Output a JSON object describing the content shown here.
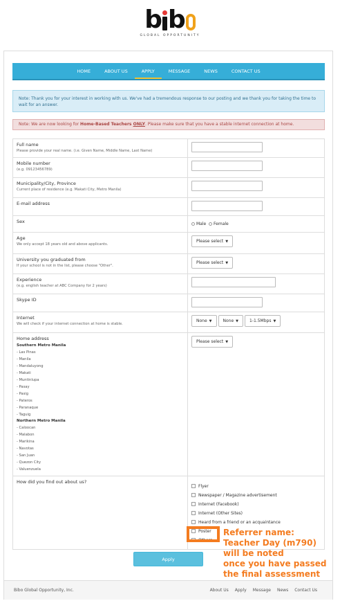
{
  "logo": {
    "tagline": "GLOBAL OPPORTUNITY"
  },
  "nav": {
    "items": [
      {
        "label": "HOME"
      },
      {
        "label": "ABOUT US"
      },
      {
        "label": "APPLY"
      },
      {
        "label": "MESSAGE"
      },
      {
        "label": "NEWS"
      },
      {
        "label": "CONTACT US"
      }
    ],
    "active": "APPLY"
  },
  "notes": {
    "info": "Note: Thank you for your interest in working with us. We've had a tremendous response to our posting and we thank you for taking the time to wait for an answer.",
    "warn_prefix": "Note: We are now looking for ",
    "warn_bold": "Home-Based Teachers ",
    "warn_only": "ONLY",
    "warn_suffix": ". Please make sure that you have a stable internet connection at home."
  },
  "form": {
    "full_name": {
      "label": "Full name",
      "hint": "Please provide your real name. (i.e. Given Name, Middle Name, Last Name)"
    },
    "mobile": {
      "label": "Mobile number",
      "hint": "(e.g. 09123456789)"
    },
    "municipality": {
      "label": "Municipality/City, Province",
      "hint": "Current place of residence (e.g. Makati City, Metro Manila)"
    },
    "email": {
      "label": "E-mail address"
    },
    "sex": {
      "label": "Sex",
      "options": [
        "Male",
        "Female"
      ]
    },
    "age": {
      "label": "Age",
      "hint": "We only accept 18 years old and above applicants.",
      "select": "Please select"
    },
    "university": {
      "label": "University you graduated from",
      "hint": "If your school is not in the list, please choose \"Other\".",
      "select": "Please select"
    },
    "experience": {
      "label": "Experience",
      "hint": "(e.g. english teacher at ABC Company for 2 years)"
    },
    "skype": {
      "label": "Skype ID"
    },
    "internet": {
      "label": "Internet",
      "hint": "We will check if your internet connection at home is stable.",
      "selects": [
        "None",
        "None",
        "1-1.5Mbps"
      ]
    },
    "home_address": {
      "label": "Home address",
      "select": "Please select",
      "south_head": "Southern Metro Manila",
      "south": [
        "- Las Pinas",
        "- Manila",
        "- Mandaluyong",
        "- Makati",
        "- Muntinlupa",
        "- Pasay",
        "- Pasig",
        "- Pateros",
        "- Paranaque",
        "- Taguig"
      ],
      "north_head": "Northern Metro Manila",
      "north": [
        "- Caloocan",
        "- Malabon",
        "- Marikina",
        "- Navotas",
        "- San Juan",
        "- Quezon City",
        "- Valuenzuela"
      ]
    },
    "source": {
      "label": "How did you find out about us?",
      "options": [
        "Flyer",
        "Newspaper / Magazine advertisement",
        "Internet (Facebook)",
        "Internet (Other Sites)",
        "Heard from a friend or an acquaintance",
        "Poster",
        "Others"
      ]
    },
    "apply_label": "Apply"
  },
  "footer": {
    "copyright": "Bibo Global Opportunity, Inc.",
    "links": [
      "About Us",
      "Apply",
      "Message",
      "News",
      "Contact Us"
    ]
  },
  "annotation": {
    "lines": [
      "Referrer name:",
      "Teacher Day (m790)",
      "will be noted",
      "once you have passed",
      "the final assessment"
    ],
    "color": "#f47c20"
  }
}
